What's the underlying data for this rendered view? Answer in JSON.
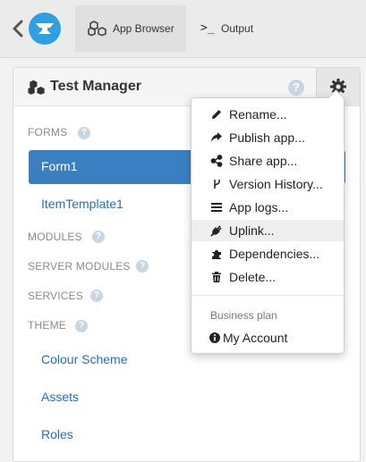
{
  "topbar": {
    "tabs": [
      {
        "label": "App Browser",
        "icon": "cubes-icon",
        "active": true
      },
      {
        "label": "Output",
        "icon": "terminal-icon",
        "active": false
      }
    ]
  },
  "panel": {
    "title": "Test Manager",
    "help_glyph": "?",
    "sections": {
      "forms": "FORMS",
      "modules": "MODULES",
      "server_modules": "SERVER MODULES",
      "services": "SERVICES",
      "theme": "THEME"
    },
    "forms": [
      "Form1",
      "ItemTemplate1"
    ],
    "theme_items": [
      "Colour Scheme",
      "Assets",
      "Roles"
    ]
  },
  "menu": {
    "items": [
      {
        "label": "Rename...",
        "icon": "pencil-icon"
      },
      {
        "label": "Publish app...",
        "icon": "share-arrow-icon"
      },
      {
        "label": "Share app...",
        "icon": "share-nodes-icon"
      },
      {
        "label": "Version History...",
        "icon": "branch-icon"
      },
      {
        "label": "App logs...",
        "icon": "list-icon"
      },
      {
        "label": "Uplink...",
        "icon": "plug-icon"
      },
      {
        "label": "Dependencies...",
        "icon": "puzzle-icon"
      },
      {
        "label": "Delete...",
        "icon": "trash-icon"
      }
    ],
    "plan_heading": "Business plan",
    "account": {
      "label": "My Account",
      "icon": "info-circle-icon"
    }
  },
  "colors": {
    "accent": "#3a7fc2",
    "link": "#2a6db5",
    "logo": "#2f9fe0"
  }
}
